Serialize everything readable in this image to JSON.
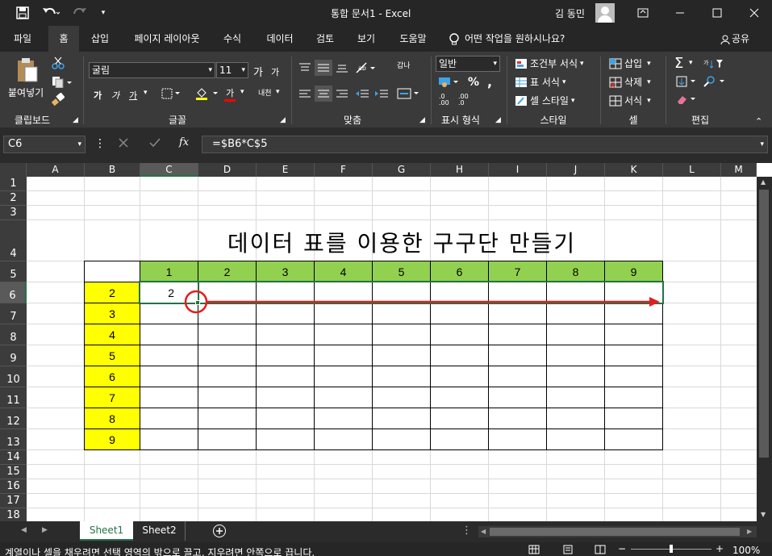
{
  "titlebar": {
    "title": "통합 문서1  -  Excel",
    "user": "김 동민",
    "icons": [
      "save-icon",
      "undo-icon",
      "redo-icon",
      "customize-qat-icon",
      "ribbon-display-icon",
      "minimize-icon",
      "maximize-icon",
      "close-icon"
    ]
  },
  "menu": {
    "tabs": [
      "파일",
      "홈",
      "삽입",
      "페이지 레이아웃",
      "수식",
      "데이터",
      "검토",
      "보기",
      "도움말"
    ],
    "active": "홈",
    "tell_me": "어떤 작업을 원하시나요?",
    "share": "공유"
  },
  "ribbon": {
    "clipboard": {
      "paste": "붙여넣기",
      "label": "클립보드"
    },
    "font": {
      "name": "굴림",
      "size": "11",
      "grow": "가",
      "shrink": "가",
      "bold": "가",
      "italic": "가",
      "underline": "가",
      "fill_letter": "가",
      "phonetic": "내천",
      "label": "글꼴"
    },
    "alignment": {
      "wrap": "갑나",
      "label": "맞춤"
    },
    "number": {
      "format": "일반",
      "percent": "%",
      "comma": ",",
      "inc": ".0 .00",
      "dec": ".00 .0",
      "label": "표시 형식"
    },
    "styles": {
      "conditional": "조건부 서식",
      "table": "표 서식",
      "cell_style": "셀 스타일",
      "label": "스타일"
    },
    "cells": {
      "insert": "삽입",
      "delete": "삭제",
      "format": "서식",
      "label": "셀"
    },
    "editing": {
      "sum": "Σ",
      "label": "편집"
    }
  },
  "formula_bar": {
    "name_box": "C6",
    "formula": "=$B6*C$5",
    "fx": "fx"
  },
  "sheet": {
    "columns": [
      "A",
      "B",
      "C",
      "D",
      "E",
      "F",
      "G",
      "H",
      "I",
      "J",
      "K",
      "L",
      "M"
    ],
    "rows": [
      "1",
      "2",
      "3",
      "4",
      "5",
      "6",
      "7",
      "8",
      "9",
      "10",
      "11",
      "12",
      "13",
      "14",
      "15",
      "16",
      "17",
      "18"
    ],
    "title": "데이터 표를 이용한 구구단 만들기",
    "header_row": [
      "1",
      "2",
      "3",
      "4",
      "5",
      "6",
      "7",
      "8",
      "9"
    ],
    "header_col": [
      "2",
      "3",
      "4",
      "5",
      "6",
      "7",
      "8",
      "9"
    ],
    "c6_value": "2",
    "selected_cell": "C6",
    "colors": {
      "header_green": "#92d050",
      "header_yellow": "#ffff00",
      "arrow_red": "#e02020",
      "selection": "#217346"
    }
  },
  "sheet_tabs": {
    "tabs": [
      "Sheet1",
      "Sheet2"
    ],
    "active": "Sheet1"
  },
  "status": {
    "message": "계열이나 셀을 채우려면 선택 영역의 밖으로 끌고, 지우려면 안쪽으로 끕니다.",
    "zoom": "100%"
  }
}
